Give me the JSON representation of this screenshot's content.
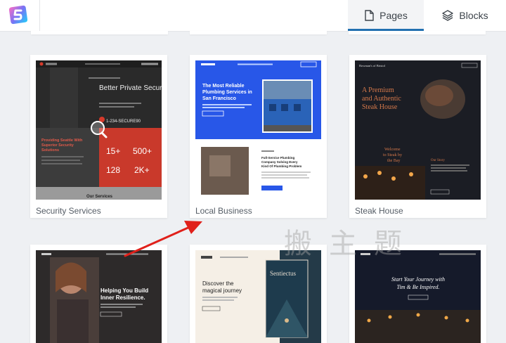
{
  "header": {
    "tabs": [
      {
        "label": "Pages",
        "icon": "page-icon",
        "active": true
      },
      {
        "label": "Blocks",
        "icon": "layers-icon",
        "active": false
      }
    ],
    "accent": "#2271b1"
  },
  "templates": [
    {
      "name": "Security Services",
      "thumb": {
        "phone": "1-234-SECURE90",
        "headline": "Better Private Security",
        "tagline": "Providing Seattle With Superior Security Solutions",
        "stats": [
          "15+",
          "500+",
          "128",
          "2K+"
        ],
        "section": "Our Services"
      }
    },
    {
      "name": "Local Business",
      "thumb": {
        "headline": "The Most Reliable Plumbing Services in San Francisco",
        "subheadline": "Full-Service Plumbing Company Solving Every Kind Of Plumbing Problem"
      }
    },
    {
      "name": "Steak House",
      "thumb": {
        "brand": "Bowman's of Bristol",
        "headline": "A Premium and Authentic Steak House",
        "welcome": "Welcome to Steak by the Bay",
        "story": "Our Story"
      }
    },
    {
      "name": "",
      "thumb": {
        "headline": "Helping You Build Inner Resilience."
      }
    },
    {
      "name": "",
      "thumb": {
        "headline": "Discover the magical journey",
        "book": "Sentiectus"
      }
    },
    {
      "name": "",
      "thumb": {
        "headline": "Start Your Journey with Tim & Be Inspired."
      }
    }
  ],
  "watermark": "搬主题"
}
